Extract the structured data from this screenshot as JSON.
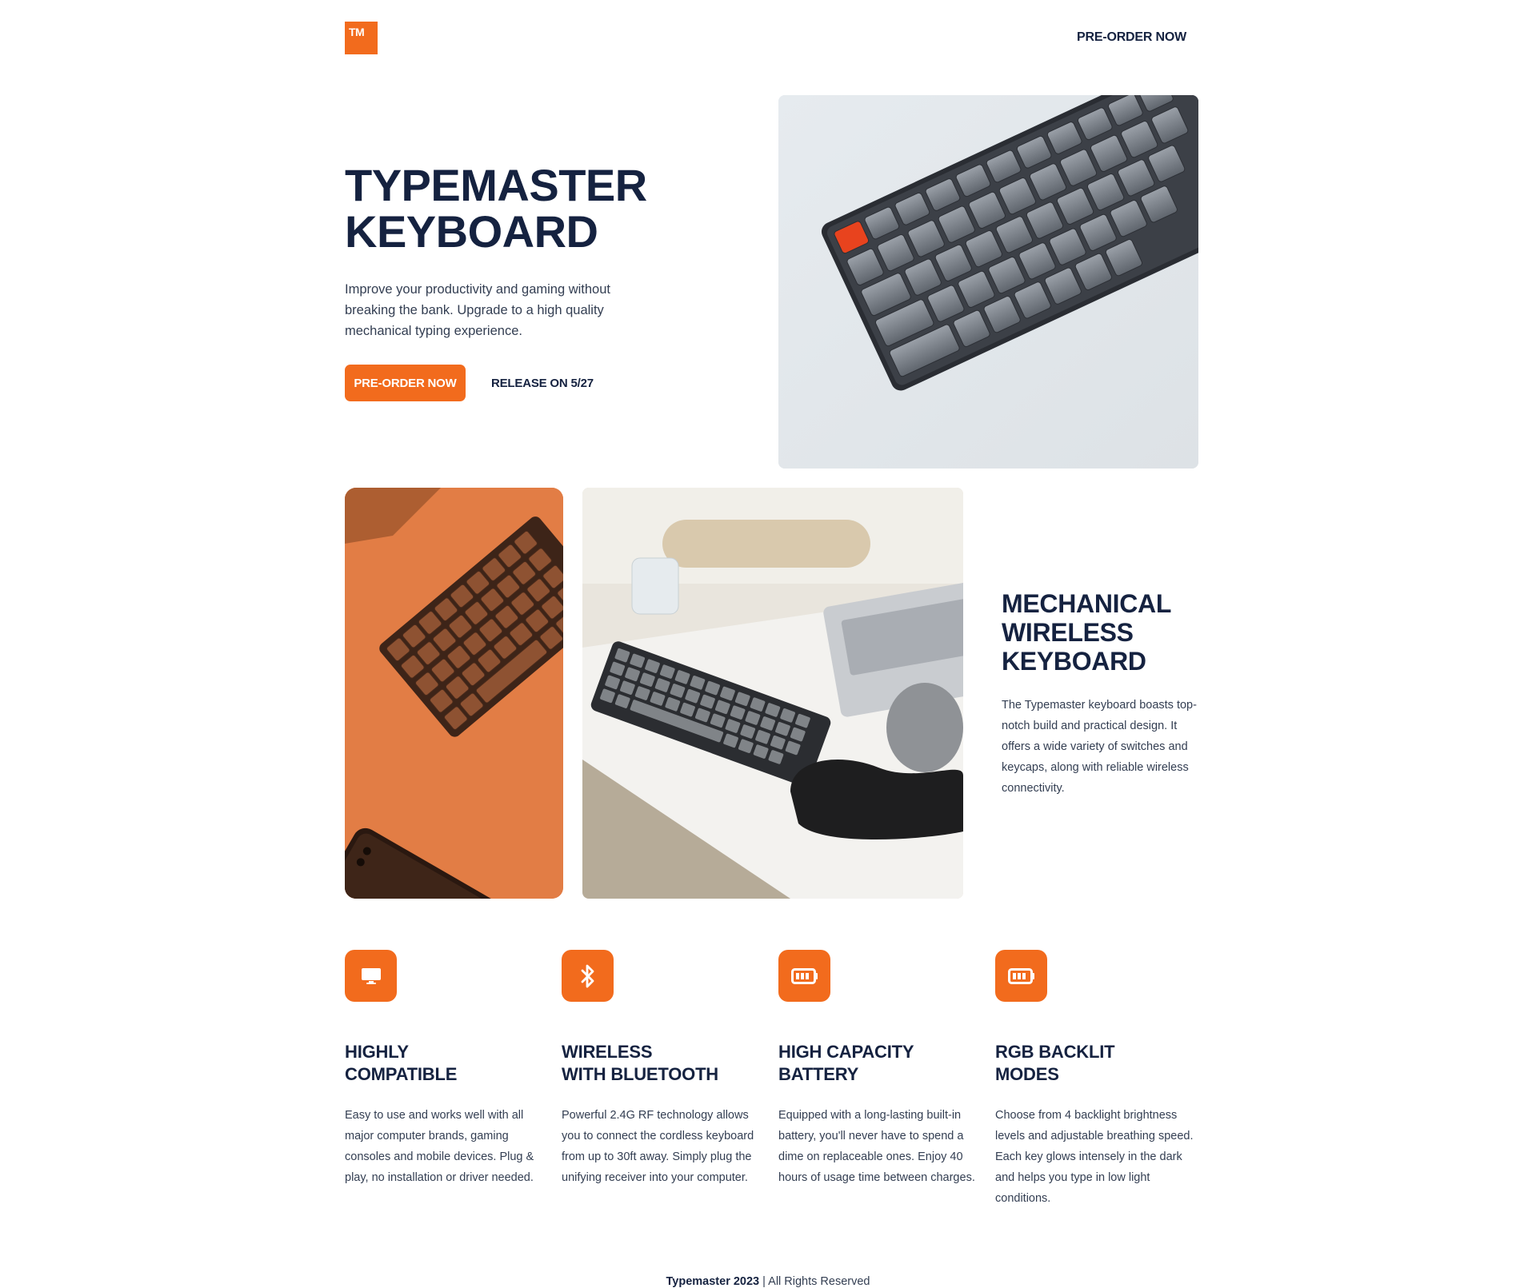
{
  "header": {
    "logo_text": "TM",
    "nav_cta": "PRE-ORDER NOW"
  },
  "hero": {
    "title_line1": "TYPEMASTER",
    "title_line2": "KEYBOARD",
    "description": "Improve your productivity and gaming without breaking the bank. Upgrade to a high quality mechanical typing experience.",
    "cta": "PRE-ORDER NOW",
    "release": "RELEASE ON 5/27"
  },
  "gallery": {
    "title_line1": "MECHANICAL",
    "title_line2": "WIRELESS",
    "title_line3": "KEYBOARD",
    "description": "The Typemaster keyboard boasts top-notch build and practical design. It offers a wide variety of switches and keycaps, along with reliable wireless connectivity."
  },
  "features": [
    {
      "icon": "monitor-icon",
      "title_line1": "HIGHLY",
      "title_line2": "COMPATIBLE",
      "description": "Easy to use and works well with all major computer brands, gaming consoles and mobile devices. Plug & play, no installation or driver needed."
    },
    {
      "icon": "bluetooth-icon",
      "title_line1": "WIRELESS",
      "title_line2": "WITH BLUETOOTH",
      "description": "Powerful 2.4G RF technology allows you to connect the cordless keyboard from up to 30ft away. Simply plug the unifying receiver into your computer."
    },
    {
      "icon": "battery-icon",
      "title_line1": "HIGH CAPACITY",
      "title_line2": "BATTERY",
      "description": "Equipped with a long-lasting built-in battery, you'll never have to spend a dime on replaceable ones. Enjoy 40 hours of usage time between charges."
    },
    {
      "icon": "battery-icon",
      "title_line1": "RGB BACKLIT",
      "title_line2": "MODES",
      "description": "Choose from 4 backlight brightness levels and adjustable breathing speed. Each key glows intensely in the dark and helps you type in low light conditions."
    }
  ],
  "footer": {
    "brand": "Typemaster 2023",
    "rights": " | All Rights Reserved"
  },
  "colors": {
    "accent": "#f26b1d",
    "heading": "#152240",
    "body": "#333e52"
  }
}
